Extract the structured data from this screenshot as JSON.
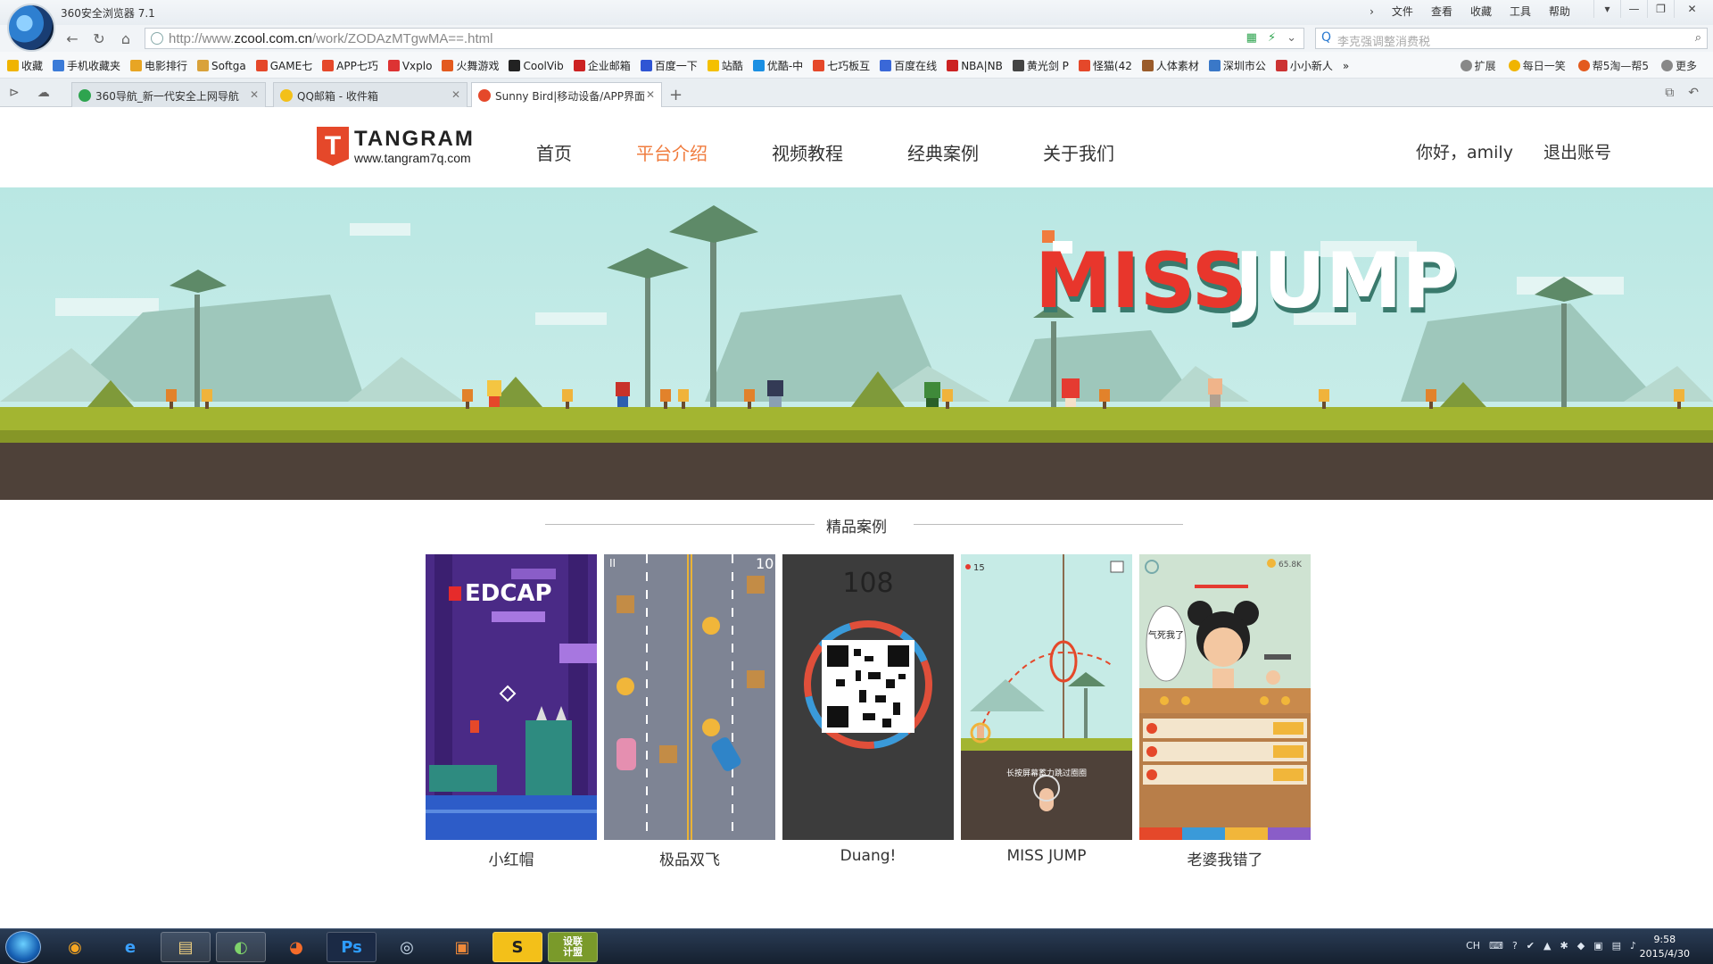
{
  "browser": {
    "app_title": "360安全浏览器 7.1",
    "menu": [
      "文件",
      "查看",
      "收藏",
      "工具",
      "帮助"
    ],
    "url_prefix": "http://www.",
    "url_domain": "zcool.com.cn",
    "url_path": "/work/ZODAzMTgwMA==.html",
    "search_placeholder": "李克强调整消费税",
    "favorites": [
      {
        "label": "收藏",
        "color": "#f0b400"
      },
      {
        "label": "手机收藏夹",
        "color": "#3b7bd8"
      },
      {
        "label": "电影排行",
        "color": "#e8a524"
      },
      {
        "label": "Softga",
        "color": "#d9a23a"
      },
      {
        "label": "GAME七",
        "color": "#e5482a"
      },
      {
        "label": "APP七巧",
        "color": "#e5482a"
      },
      {
        "label": "Vxplo",
        "color": "#d33"
      },
      {
        "label": "火舞游戏",
        "color": "#e35a1e"
      },
      {
        "label": "CoolVib",
        "color": "#222"
      },
      {
        "label": "企业邮箱",
        "color": "#c22"
      },
      {
        "label": "百度一下",
        "color": "#2f55d4"
      },
      {
        "label": "站酷",
        "color": "#f4c000"
      },
      {
        "label": "优酷-中",
        "color": "#1a8fe3"
      },
      {
        "label": "七巧板互",
        "color": "#e5482a"
      },
      {
        "label": "百度在线",
        "color": "#3a68d8"
      },
      {
        "label": "NBA|NB",
        "color": "#c22"
      },
      {
        "label": "黄光剑 P",
        "color": "#444"
      },
      {
        "label": "怪猫(42",
        "color": "#e5482a"
      },
      {
        "label": "人体素材",
        "color": "#9a5b2a"
      },
      {
        "label": "深圳市公",
        "color": "#3a78c8"
      },
      {
        "label": "小小新人",
        "color": "#c33"
      }
    ],
    "fav_more": "»",
    "fav_right": [
      {
        "label": "扩展",
        "color": "#888"
      },
      {
        "label": "每日一笑",
        "color": "#f0b400"
      },
      {
        "label": "帮5淘—帮5",
        "color": "#e35a1e"
      },
      {
        "label": "更多",
        "color": "#888"
      }
    ],
    "tabs": [
      {
        "label": "360导航_新一代安全上网导航",
        "color": "#2ea44f"
      },
      {
        "label": "QQ邮箱 - 收件箱",
        "color": "#f3c019"
      },
      {
        "label": "Sunny Bird|移动设备/APP界面",
        "color": "#e5482a"
      }
    ]
  },
  "site": {
    "brand_name": "TANGRAM",
    "brand_letter": "T",
    "brand_url": "www.tangram7q.com",
    "nav": [
      "首页",
      "平台介绍",
      "视频教程",
      "经典案例",
      "关于我们"
    ],
    "active_nav_index": 1,
    "greeting": "你好，amily",
    "logout": "退出账号",
    "banner_title_1": "MISS",
    "banner_title_2": "JUMP",
    "section_title": "精品案例",
    "cases": [
      {
        "name": "小红帽",
        "overlay": "EDCAP"
      },
      {
        "name": "极品双飞",
        "overlay": "10"
      },
      {
        "name": "Duang!",
        "overlay": "108"
      },
      {
        "name": "MISS JUMP",
        "overlay": "15",
        "caption": "长按屏幕蓄力跳过圈圈"
      },
      {
        "name": "老婆我错了",
        "overlay": "65.8K",
        "bubble": "气死我了"
      }
    ]
  },
  "taskbar": {
    "tray": [
      "CH",
      "⌨",
      "?",
      "✔",
      "▲",
      "✱",
      "◆",
      "▣",
      "▤",
      "🔊"
    ],
    "time": "9:58",
    "date": "2015/4/30",
    "pinned_label": "设联\n计盟"
  },
  "colors": {
    "accent": "#f07c3e",
    "brand": "#e5482a",
    "sky": "#c2eae6",
    "grass": "#a3b531",
    "soil": "#4e4139"
  }
}
